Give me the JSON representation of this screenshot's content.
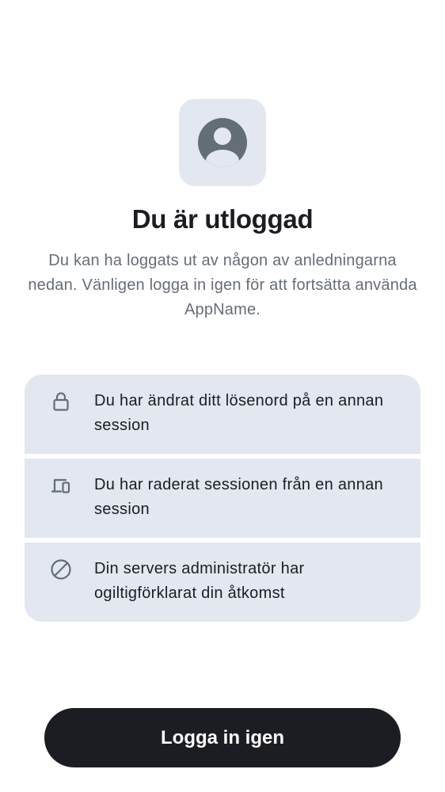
{
  "header": {
    "avatar_icon": "user-profile-icon",
    "title": "Du är utloggad",
    "subtitle": "Du kan ha loggats ut av någon av anledningarna nedan. Vänligen logga in igen för att fortsätta använda AppName."
  },
  "reasons": [
    {
      "icon": "lock-icon",
      "text": "Du har ändrat ditt lösenord på en annan session"
    },
    {
      "icon": "devices-icon",
      "text": "Du har raderat sessionen från en annan session"
    },
    {
      "icon": "block-icon",
      "text": "Din servers administratör har ogiltigförklarat din åtkomst"
    }
  ],
  "actions": {
    "login_label": "Logga in igen"
  },
  "colors": {
    "tile_background": "#e2e7f0",
    "icon": "#656d77",
    "primary_text": "#1b1d22",
    "secondary_text": "#656d77",
    "button_background": "#1b1d22",
    "button_text": "#ffffff"
  }
}
